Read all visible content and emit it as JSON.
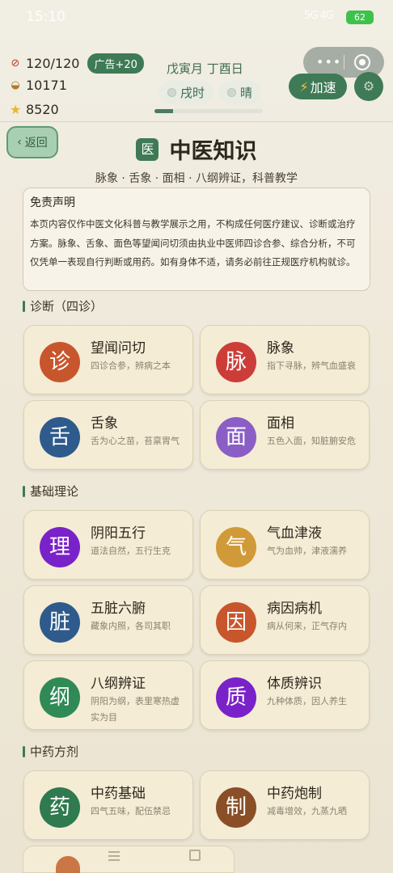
{
  "status_bar": {
    "time": "15:10",
    "signal": "5G 4G",
    "battery": "62"
  },
  "resources": {
    "energy": "120/120",
    "ad_bonus": "广告+20",
    "coins": "10171",
    "stars": "8520"
  },
  "calendar": {
    "date": "戊寅月 丁酉日",
    "hour": "戌时",
    "weather": "晴",
    "day_progress": 0.17
  },
  "buttons": {
    "speed": "加速",
    "back": "返回"
  },
  "page": {
    "badge": "医",
    "title": "中医知识",
    "subtitle": "脉象 · 舌象 · 面相 · 八纲辨证，科普教学"
  },
  "disclaimer": {
    "title": "免责声明",
    "body": "本页内容仅作中医文化科普与教学展示之用，不构成任何医疗建议、诊断或治疗方案。脉象、舌象、面色等望闻问切须由执业中医师四诊合参、综合分析，不可仅凭单一表现自行判断或用药。如有身体不适，请务必前往正规医疗机构就诊。"
  },
  "sections": {
    "diagnosis": {
      "title": "诊断（四诊）",
      "cards": [
        {
          "glyph": "诊",
          "name": "望闻问切",
          "desc": "四诊合参，辨病之本",
          "color": "#c8562c"
        },
        {
          "glyph": "脉",
          "name": "脉象",
          "desc": "指下寻脉，辨气血盛衰",
          "color": "#cc3d3a"
        },
        {
          "glyph": "舌",
          "name": "舌象",
          "desc": "舌为心之苗，苔禀胃气",
          "color": "#2f5b8c"
        },
        {
          "glyph": "面",
          "name": "面相",
          "desc": "五色入面，知脏腑安危",
          "color": "#8a5ec4"
        }
      ]
    },
    "theory": {
      "title": "基础理论",
      "cards": [
        {
          "glyph": "理",
          "name": "阴阳五行",
          "desc": "道法自然，五行生克",
          "color": "#7a22c9"
        },
        {
          "glyph": "气",
          "name": "气血津液",
          "desc": "气为血帅，津液濡养",
          "color": "#d19a38"
        },
        {
          "glyph": "脏",
          "name": "五脏六腑",
          "desc": "藏象内照，各司其职",
          "color": "#2f5b8c"
        },
        {
          "glyph": "因",
          "name": "病因病机",
          "desc": "病从何来，正气存内",
          "color": "#c8562c"
        },
        {
          "glyph": "纲",
          "name": "八纲辨证",
          "desc": "阴阳为纲，表里寒热虚实为目",
          "color": "#2f8a56"
        },
        {
          "glyph": "质",
          "name": "体质辨识",
          "desc": "九种体质，因人养生",
          "color": "#7a22c9"
        }
      ]
    },
    "herbs": {
      "title": "中药方剂",
      "cards": [
        {
          "glyph": "药",
          "name": "中药基础",
          "desc": "四气五味，配伍禁忌",
          "color": "#2f7a4f"
        },
        {
          "glyph": "制",
          "name": "中药炮制",
          "desc": "减毒增效，九蒸九晒",
          "color": "#8a4f26"
        }
      ]
    }
  }
}
